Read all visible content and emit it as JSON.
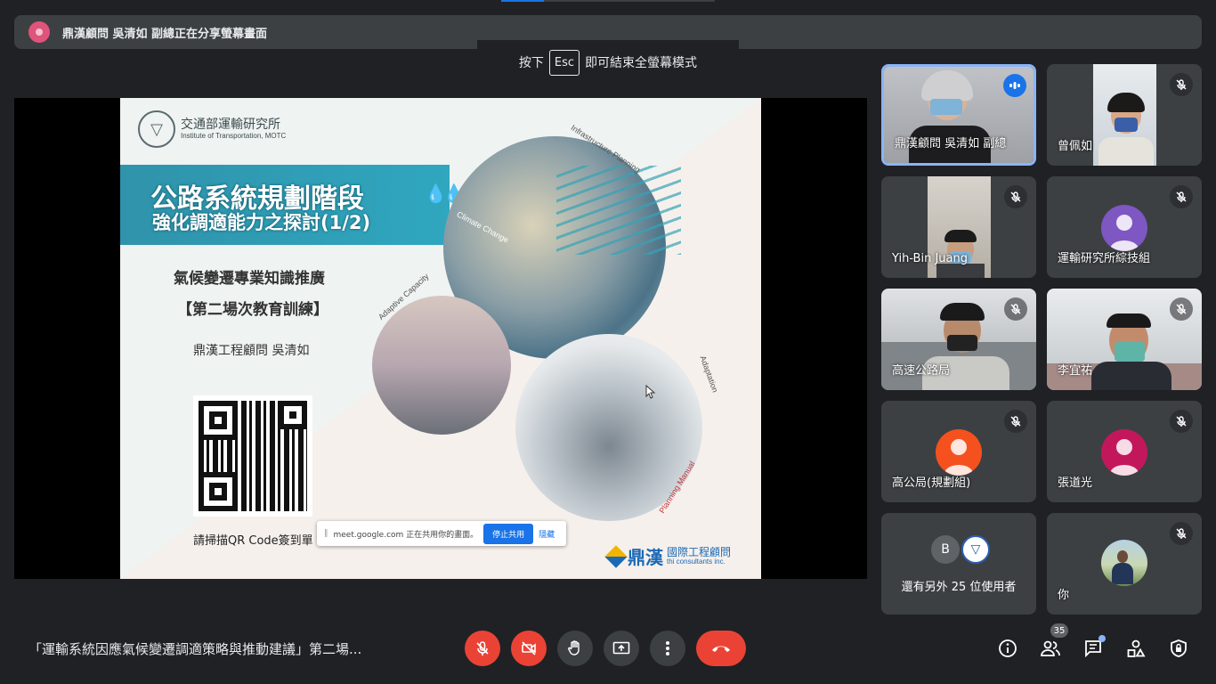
{
  "banner": {
    "text": "鼎漢顧問 吳清如 副總正在分享螢幕畫面"
  },
  "esc_hint": {
    "prefix": "按下",
    "key": "Esc",
    "suffix": "即可結束全螢幕模式"
  },
  "slide": {
    "org_zh": "交通部運輸研究所",
    "org_en": "Institute of Transportation, MOTC",
    "title_line1": "公路系統規劃階段",
    "title_line2": "強化調適能力之探討(1/2)",
    "subtitle1": "氣候變遷專業知識推廣",
    "subtitle2": "【第二場次教育訓練】",
    "presenter": "鼎漢工程顧問 吳清如",
    "scan_text": "請掃描QR Code簽到單",
    "label_infra": "Infrastructure Planning",
    "label_climate": "Climate Change",
    "label_adaptive": "Adaptive Capacity",
    "label_adaptation": "Adaptation",
    "label_manual": "Planning Manual",
    "brand_zh": "鼎漢",
    "brand_zh2": "國際工程顧問",
    "brand_en": "thi consultants inc."
  },
  "share_bar": {
    "text": "meet.google.com 正在共用你的畫面。",
    "stop_label": "停止共用",
    "hide_label": "隱藏"
  },
  "participants": [
    {
      "name": "鼎漢顧問 吳清如 副總",
      "speaking": true
    },
    {
      "name": "曾佩如",
      "muted": true
    },
    {
      "name": "Yih-Bin Juang",
      "muted": true
    },
    {
      "name": "運輸研究所綜技組",
      "muted": true,
      "avatar_color": "#7e57c2"
    },
    {
      "name": "高速公路局",
      "muted": true
    },
    {
      "name": "李宜祐",
      "muted": true
    },
    {
      "name": "高公局(規劃組)",
      "muted": true,
      "avatar_color": "#f4511e"
    },
    {
      "name": "張道光",
      "muted": true,
      "avatar_color": "#c2185b"
    },
    {
      "name": "還有另外 25 位使用者",
      "overflow_initial": "B"
    },
    {
      "name": "你",
      "muted": true
    }
  ],
  "meeting": {
    "title": "「運輸系統因應氣候變遷調適策略與推動建議」第二場...",
    "participant_count": "35"
  },
  "icons": {
    "mic_off": "mic-off-icon",
    "cam_off": "camera-off-icon",
    "hand": "raise-hand-icon",
    "present": "present-screen-icon",
    "more": "more-vert-icon",
    "hangup": "call-end-icon",
    "info": "info-icon",
    "people": "people-icon",
    "chat": "chat-icon",
    "activities": "activities-icon",
    "host": "host-controls-icon"
  },
  "colors": {
    "background": "#202124",
    "danger": "#ea4335",
    "accent": "#1a73e8"
  }
}
